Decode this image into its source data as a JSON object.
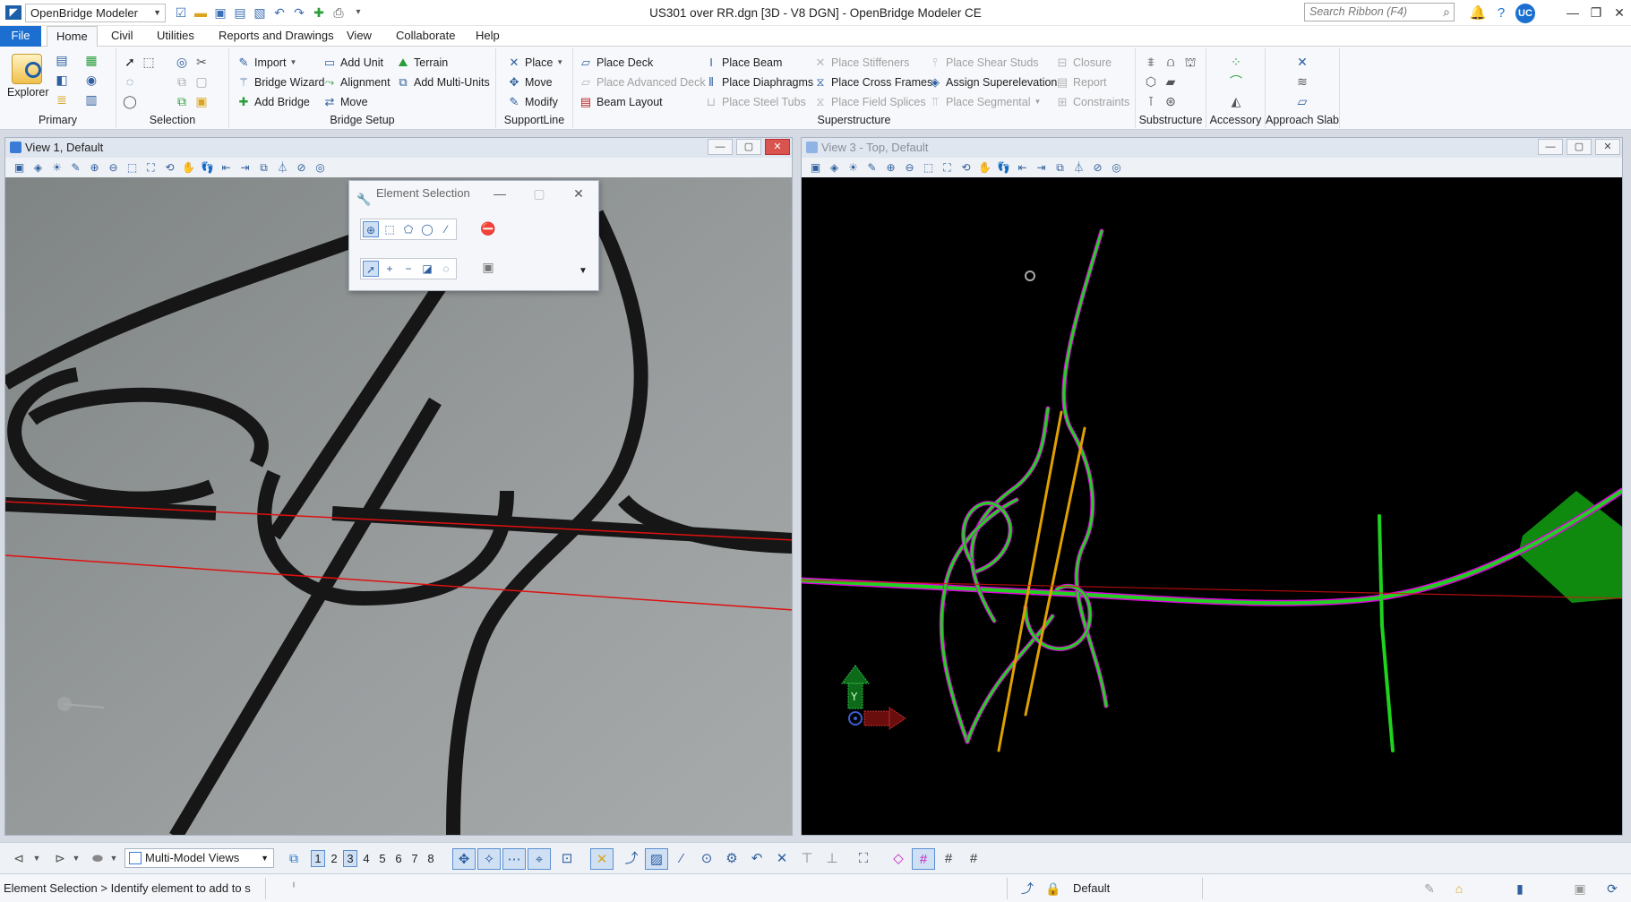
{
  "app": {
    "workflow": "OpenBridge Modeler",
    "title": "US301 over RR.dgn [3D - V8 DGN] - OpenBridge Modeler CE",
    "search_placeholder": "Search Ribbon (F4)",
    "user_initials": "UC"
  },
  "tabs": [
    "File",
    "Home",
    "Civil",
    "Utilities",
    "Reports and Drawings",
    "View",
    "Collaborate",
    "Help"
  ],
  "ribbon": {
    "primary": {
      "label": "Primary",
      "explorer": "Explorer"
    },
    "selection": {
      "label": "Selection"
    },
    "bridge_setup": {
      "label": "Bridge Setup",
      "import": "Import",
      "bridge_wizard": "Bridge Wizard",
      "add_bridge": "Add Bridge",
      "add_unit": "Add Unit",
      "alignment": "Alignment",
      "move": "Move",
      "terrain": "Terrain",
      "add_multi_units": "Add Multi-Units"
    },
    "supportline": {
      "label": "SupportLine",
      "place": "Place",
      "move": "Move",
      "modify": "Modify"
    },
    "superstructure": {
      "label": "Superstructure",
      "place_deck": "Place Deck",
      "place_advanced_deck": "Place Advanced Deck",
      "beam_layout": "Beam Layout",
      "place_beam": "Place Beam",
      "place_diaphragms": "Place Diaphragms",
      "place_steel_tubs": "Place Steel Tubs",
      "place_stiffeners": "Place Stiffeners",
      "place_cross_frames": "Place Cross Frames",
      "place_field_splices": "Place Field Splices",
      "place_shear_studs": "Place Shear Studs",
      "assign_superelevation": "Assign Superelevation",
      "place_segmental": "Place Segmental",
      "closure": "Closure",
      "report": "Report",
      "constraints": "Constraints"
    },
    "substructure": {
      "label": "Substructure"
    },
    "accessory": {
      "label": "Accessory"
    },
    "approach_slab": {
      "label": "Approach Slab"
    }
  },
  "views": {
    "view1": {
      "title": "View 1, Default"
    },
    "view3": {
      "title": "View 3 - Top, Default"
    }
  },
  "element_selection": {
    "title": "Element Selection"
  },
  "viewbar": {
    "multi_model": "Multi-Model Views",
    "view_numbers": [
      "1",
      "2",
      "3",
      "4",
      "5",
      "6",
      "7",
      "8"
    ],
    "active_views": [
      "1",
      "3"
    ]
  },
  "status": {
    "message": "Element Selection > Identify element to add to s",
    "level": "Default"
  },
  "colors": {
    "accent": "#1c6fd0",
    "road_green": "#1ed21e",
    "road_magenta": "#e000e0",
    "road_orange": "#e0a000",
    "railroad_red": "#e01010",
    "view1_bg": "#8f9394",
    "view3_bg": "#000000"
  }
}
